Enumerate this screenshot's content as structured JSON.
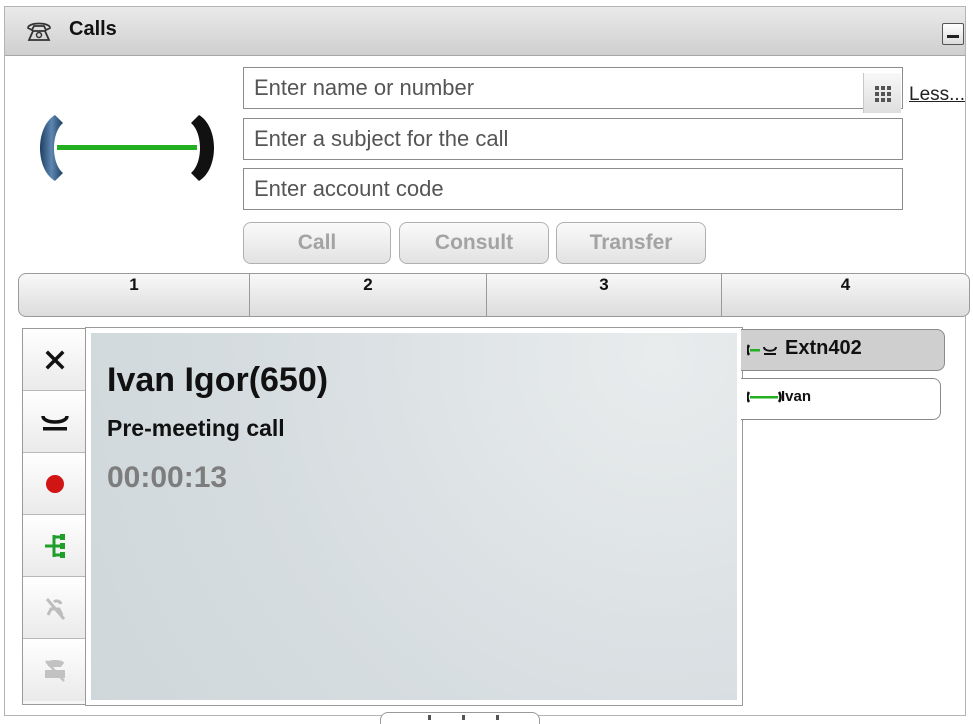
{
  "window": {
    "title": "Calls"
  },
  "search": {
    "placeholder": "Enter name or number"
  },
  "subject": {
    "placeholder": "Enter a subject for the call"
  },
  "account": {
    "placeholder": "Enter account code"
  },
  "less_link": "Less...",
  "buttons": {
    "call": "Call",
    "consult": "Consult",
    "transfer": "Transfer"
  },
  "tabs": [
    "1",
    "2",
    "3",
    "4"
  ],
  "active_call": {
    "name": "Ivan Igor(650)",
    "subject": "Pre-meeting call",
    "timer": "00:00:13"
  },
  "call_list": [
    {
      "label": "Extn402",
      "status": "on-hold",
      "icon": "held-call-icon"
    },
    {
      "label": "Ivan",
      "status": "connected",
      "icon": "connected-call-icon"
    }
  ],
  "actions": [
    {
      "name": "drop-call-icon"
    },
    {
      "name": "hold-call-icon"
    },
    {
      "name": "record-call-icon"
    },
    {
      "name": "conference-icon"
    },
    {
      "name": "mute-icon"
    },
    {
      "name": "park-call-icon"
    }
  ],
  "colors": {
    "connected_green": "#22b022",
    "record_red": "#d11414",
    "conference_green": "#1f9e2a",
    "timer_gray": "#7d7d7d"
  }
}
